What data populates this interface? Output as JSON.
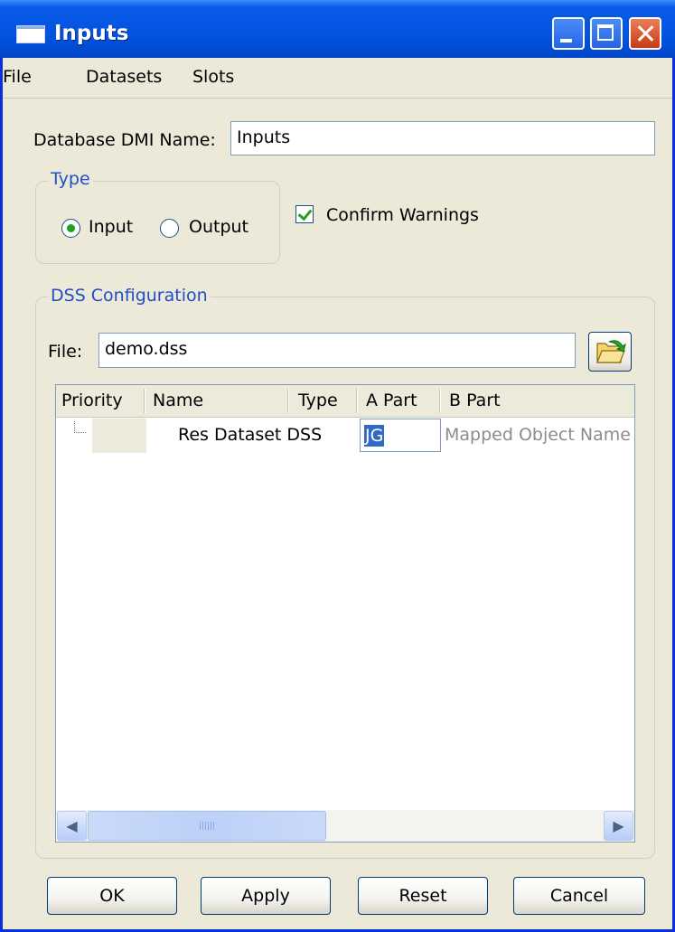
{
  "window": {
    "title": "Inputs"
  },
  "menu": [
    "File",
    "Datasets",
    "Slots"
  ],
  "form": {
    "dmi_label": "Database DMI Name:",
    "dmi_value": "Inputs",
    "type_group": "Type",
    "type_options": [
      "Input",
      "Output"
    ],
    "type_selected": "Input",
    "confirm_label": "Confirm Warnings",
    "confirm_checked": true
  },
  "dss": {
    "group_title": "DSS Configuration",
    "file_label": "File:",
    "file_value": "demo.dss",
    "columns": [
      "Priority",
      "Name",
      "Type",
      "A Part",
      "B Part"
    ],
    "rows": [
      {
        "priority": "",
        "name": "Res Dataset DSS",
        "type": "",
        "a_part": "JG",
        "b_part": "Mapped Object Name"
      }
    ]
  },
  "buttons": [
    "OK",
    "Apply",
    "Reset",
    "Cancel"
  ],
  "colors": {
    "title_blue": "#0353e0",
    "group_title": "#1e4fc9",
    "selection": "#316ac5"
  }
}
